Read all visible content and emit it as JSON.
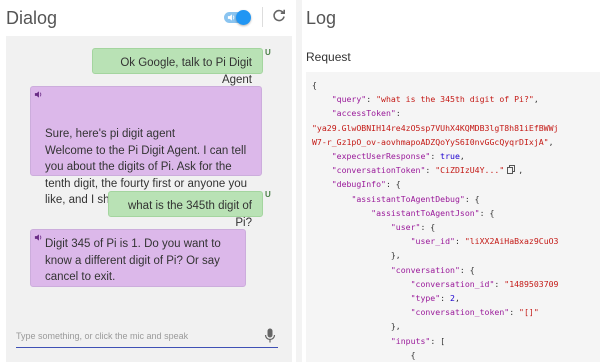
{
  "dialog": {
    "title": "Dialog",
    "input_placeholder": "Type something, or click the mic and speak",
    "messages": [
      {
        "role": "user",
        "badge": "U",
        "text": "Ok Google, talk to Pi Digit Agent"
      },
      {
        "role": "agent",
        "text": "Sure, here's pi digit agent\nWelcome to the Pi Digit Agent. I can tell you about the digits of Pi. Ask for the tenth digit, the fourty first or anyone you like, and I shall tell you which one it is!"
      },
      {
        "role": "user",
        "badge": "U",
        "text": "what is the 345th digit of Pi?"
      },
      {
        "role": "agent",
        "text": "Digit 345 of Pi is 1. Do you want to know a different digit of Pi? Or say cancel to exit."
      }
    ]
  },
  "log": {
    "title": "Log",
    "request_label": "Request",
    "code": {
      "open": "{",
      "query_key": "\"query\"",
      "query_val": "\"what is the 345th digit of Pi?\"",
      "access_key": "\"accessToken\"",
      "access_val_1": "\"ya29.GlwOBNIH14re4zO5sp7VUhX4KQMDB3lgT8h81iEfBWWj",
      "access_val_2": "W7-r_Gz1pO_ov-aovhmapoADZQoYyS6I0nvGGcQyqrDIxjA\"",
      "expect_key": "\"expectUserResponse\"",
      "expect_val": "true",
      "conv_token_key": "\"conversationToken\"",
      "conv_token_val": "\"CiZDIzU4Y...\"",
      "debug_key": "\"debugInfo\"",
      "agent_debug_key": "\"assistantToAgentDebug\"",
      "agent_json_key": "\"assistantToAgentJson\"",
      "user_key": "\"user\"",
      "user_id_key": "\"user_id\"",
      "user_id_val": "\"liXX2AiHaBxaz9CuO3",
      "conversation_key": "\"conversation\"",
      "conversation_id_key": "\"conversation_id\"",
      "conversation_id_val": "\"1489503709",
      "type_key": "\"type\"",
      "type_val": "2",
      "conversation_token_key": "\"conversation_token\"",
      "conversation_token_val": "\"[]\"",
      "inputs_key": "\"inputs\""
    }
  },
  "colors": {
    "user_bubble": "#b9e2b5",
    "agent_bubble": "#dcb8ea",
    "accent_blue": "#2196f3",
    "json_key": "#9a1a9a",
    "json_string": "#c41a16",
    "json_number": "#1c00cf"
  },
  "icons": [
    "speaker-icon",
    "toggle-switch",
    "refresh-icon",
    "agent-speaker-icon",
    "mic-icon",
    "copy-icon"
  ]
}
